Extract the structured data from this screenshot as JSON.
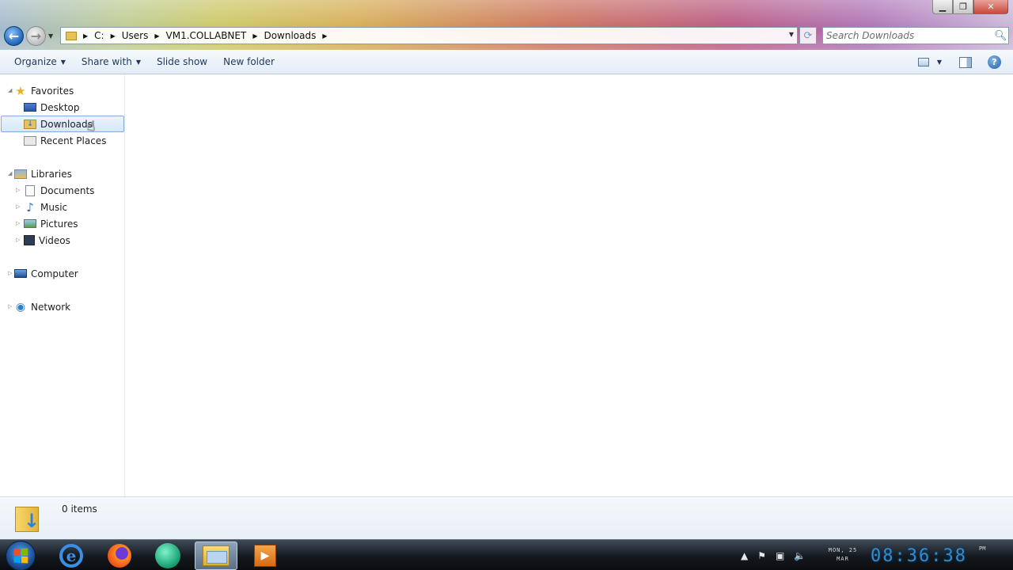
{
  "window": {
    "controls": {
      "minimize": "▁",
      "maximize": "❐",
      "close": "✕"
    }
  },
  "nav": {
    "back_glyph": "←",
    "forward_glyph": "→",
    "history_glyph": "▼"
  },
  "address": {
    "crumbs": [
      "C:",
      "Users",
      "VM1.COLLABNET",
      "Downloads"
    ],
    "crumb_sep": "▶",
    "dropdown_glyph": "▼",
    "refresh_glyph": "⟳"
  },
  "search": {
    "placeholder": "Search Downloads",
    "icon": "search-icon"
  },
  "toolbar": {
    "organize": "Organize",
    "share_with": "Share with",
    "slide_show": "Slide show",
    "new_folder": "New folder",
    "caret": "▼",
    "help": "?"
  },
  "navpane": {
    "favorites": "Favorites",
    "desktop": "Desktop",
    "downloads": "Downloads",
    "recent_places": "Recent Places",
    "libraries": "Libraries",
    "documents": "Documents",
    "music": "Music",
    "pictures": "Pictures",
    "videos": "Videos",
    "computer": "Computer",
    "network": "Network",
    "expanded_glyph": "◢",
    "collapsed_glyph": "▷"
  },
  "details": {
    "items_count": "0 items"
  },
  "taskbar": {
    "apps": [
      "internet-explorer",
      "firefox",
      "globe-app",
      "windows-explorer",
      "media-player"
    ],
    "ie_glyph": "e",
    "media_glyph": "▶",
    "tray": {
      "show_hidden": "▲",
      "flag": "⚑",
      "network": "▣",
      "volume": "🔈"
    },
    "date_line1": "MON, 25",
    "date_line2": "MAR",
    "clock": "08:36:38",
    "ampm": "PM"
  },
  "colors": {
    "accent": "#1e395b",
    "selection_border": "#84acdd",
    "clock": "#2f8cd0"
  }
}
